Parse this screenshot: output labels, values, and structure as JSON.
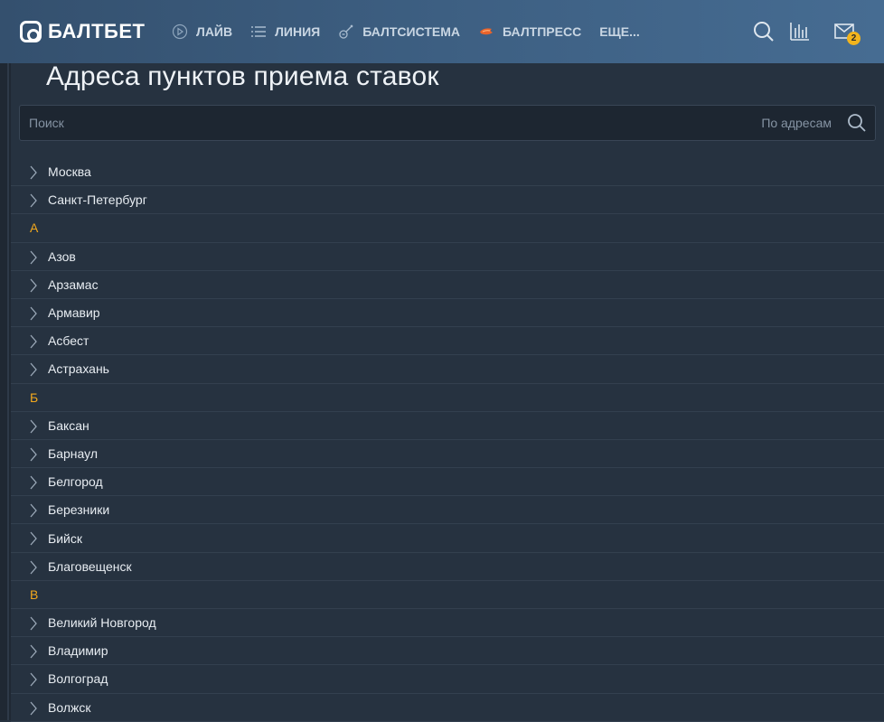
{
  "header": {
    "logo_text": "БАЛТБЕТ",
    "nav": [
      {
        "label": "ЛАЙВ",
        "icon": "play-circle-icon"
      },
      {
        "label": "ЛИНИЯ",
        "icon": "list-icon"
      },
      {
        "label": "БАЛТСИСТЕМА",
        "icon": "guitar-icon"
      },
      {
        "label": "БАЛТПРЕСС",
        "icon": "press-flame-icon"
      },
      {
        "label": "ЕЩЕ...",
        "icon": ""
      }
    ],
    "search_icon": "search-icon",
    "stats_icon": "statistics-icon",
    "mail_icon": "mail-icon",
    "mail_badge": "2",
    "accent": "#f2b41d",
    "nav_accent": "#e8632b"
  },
  "page": {
    "title": "Адреса пунктов приема ставок"
  },
  "search": {
    "placeholder": "Поиск",
    "value": "",
    "mode": "По адресам"
  },
  "list": [
    {
      "type": "city",
      "name": "Москва"
    },
    {
      "type": "city",
      "name": "Санкт-Петербург"
    },
    {
      "type": "letter",
      "name": "А"
    },
    {
      "type": "city",
      "name": "Азов"
    },
    {
      "type": "city",
      "name": "Арзамас"
    },
    {
      "type": "city",
      "name": "Армавир"
    },
    {
      "type": "city",
      "name": "Асбест"
    },
    {
      "type": "city",
      "name": "Астрахань"
    },
    {
      "type": "letter",
      "name": "Б"
    },
    {
      "type": "city",
      "name": "Баксан"
    },
    {
      "type": "city",
      "name": "Барнаул"
    },
    {
      "type": "city",
      "name": "Белгород"
    },
    {
      "type": "city",
      "name": "Березники"
    },
    {
      "type": "city",
      "name": "Бийск"
    },
    {
      "type": "city",
      "name": "Благовещенск"
    },
    {
      "type": "letter",
      "name": "В"
    },
    {
      "type": "city",
      "name": "Великий Новгород"
    },
    {
      "type": "city",
      "name": "Владимир"
    },
    {
      "type": "city",
      "name": "Волгоград"
    },
    {
      "type": "city",
      "name": "Волжск"
    }
  ],
  "colors": {
    "background": "#263240",
    "letter": "#f2a81d",
    "header_start": "#34506e",
    "header_end": "#466c92"
  }
}
